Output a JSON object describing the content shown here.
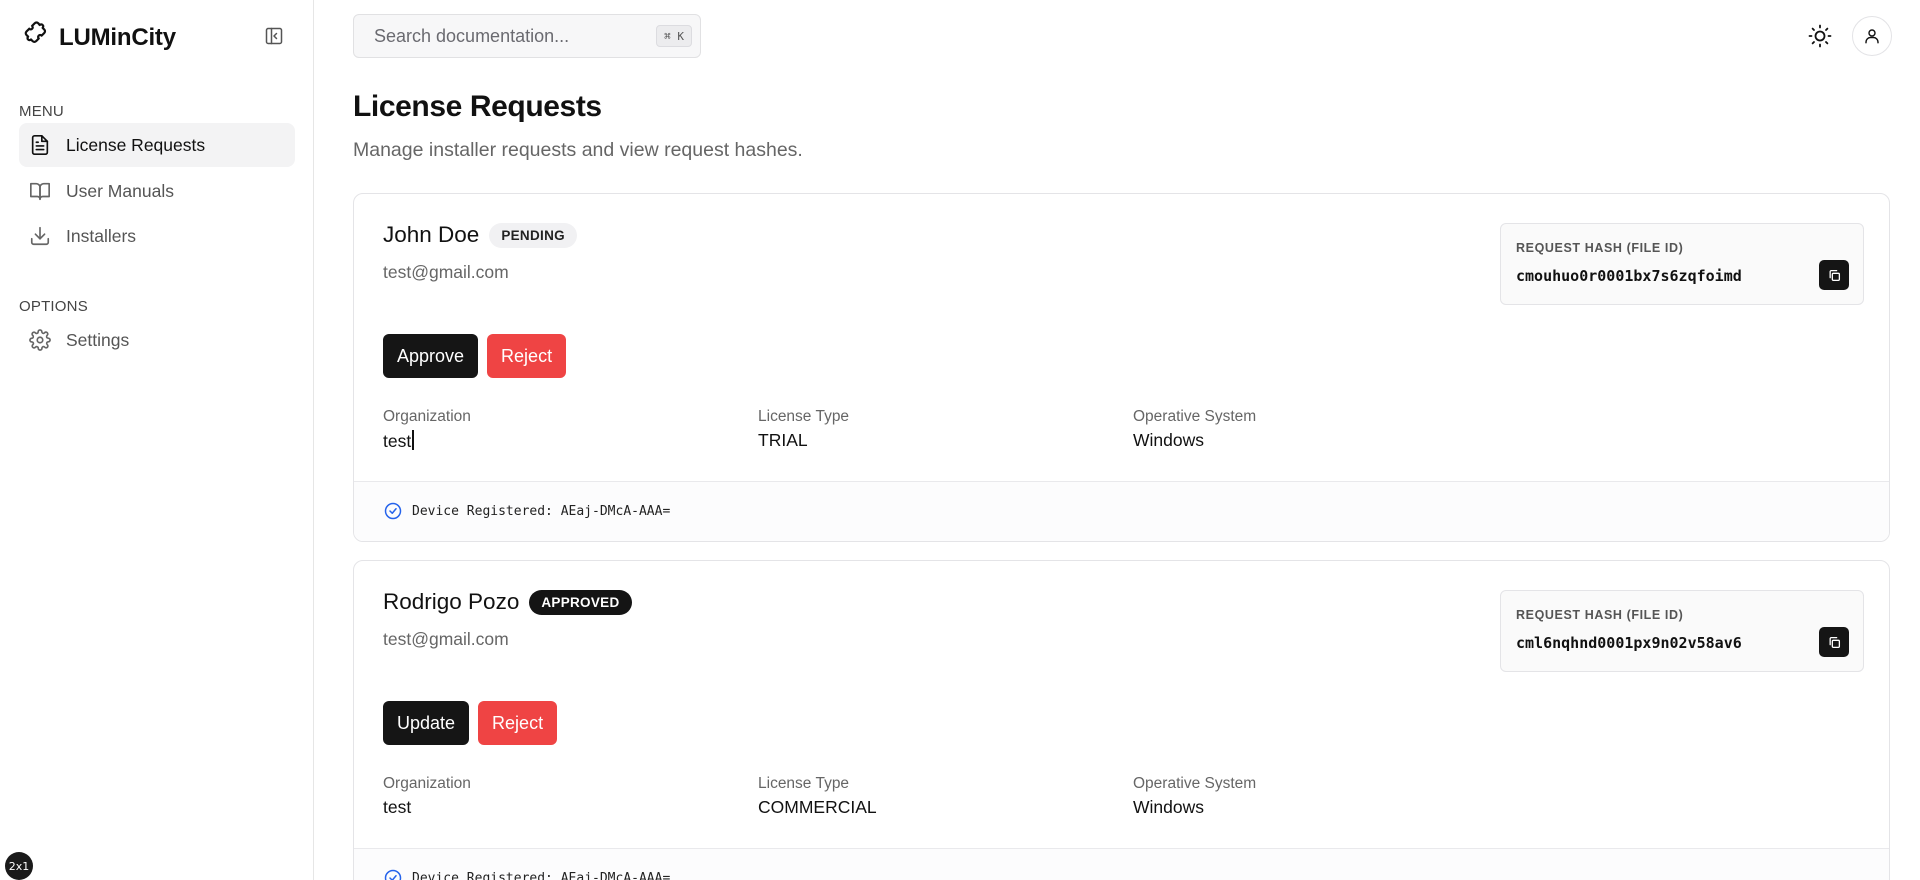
{
  "brand": {
    "name": "LUMinCity"
  },
  "sidebar": {
    "menu_label": "MENU",
    "options_label": "OPTIONS",
    "items": [
      {
        "label": "License Requests",
        "icon": "document-icon",
        "active": true
      },
      {
        "label": "User Manuals",
        "icon": "book-icon",
        "active": false
      },
      {
        "label": "Installers",
        "icon": "download-icon",
        "active": false
      }
    ],
    "options": [
      {
        "label": "Settings",
        "icon": "gear-icon"
      }
    ]
  },
  "header": {
    "search_placeholder": "Search documentation...",
    "search_shortcut": "⌘ K"
  },
  "page": {
    "title": "License Requests",
    "subtitle": "Manage installer requests and view request hashes."
  },
  "requests": [
    {
      "name": "John Doe",
      "status": "PENDING",
      "email": "test@gmail.com",
      "primary_action": "Approve",
      "secondary_action": "Reject",
      "org_label": "Organization",
      "org_value": "test",
      "license_label": "License Type",
      "license_value": "TRIAL",
      "os_label": "Operative System",
      "os_value": "Windows",
      "hash_label": "REQUEST HASH (FILE ID)",
      "hash_value": "cmouhuo0r0001bx7s6zqfoimd",
      "device_text": "Device Registered: AEaj-DMcA-AAA="
    },
    {
      "name": "Rodrigo Pozo",
      "status": "APPROVED",
      "email": "test@gmail.com",
      "primary_action": "Update",
      "secondary_action": "Reject",
      "org_label": "Organization",
      "org_value": "test",
      "license_label": "License Type",
      "license_value": "COMMERCIAL",
      "os_label": "Operative System",
      "os_value": "Windows",
      "hash_label": "REQUEST HASH (FILE ID)",
      "hash_value": "cml6nqhnd0001px9n02v58av6",
      "device_text": "Device Registered: AEaj-DMcA-AAA="
    }
  ],
  "corner_badge": "2x1",
  "colors": {
    "accent_dark": "#151515",
    "reject_red": "#ef4444",
    "check_blue": "#2563eb"
  }
}
